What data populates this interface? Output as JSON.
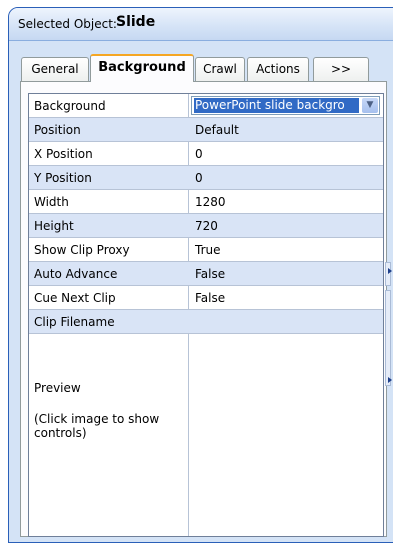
{
  "header": {
    "label": "Selected Object:",
    "value": "Slide"
  },
  "tabs": [
    {
      "label": "General",
      "active": false
    },
    {
      "label": "Background",
      "active": true
    },
    {
      "label": "Crawl",
      "active": false
    },
    {
      "label": "Actions",
      "active": false
    },
    {
      "label": ">>",
      "active": false
    }
  ],
  "properties": [
    {
      "name": "Background",
      "value": "PowerPoint slide backgro"
    },
    {
      "name": "Position",
      "value": "Default"
    },
    {
      "name": "X Position",
      "value": "0"
    },
    {
      "name": "Y Position",
      "value": "0"
    },
    {
      "name": "Width",
      "value": "1280"
    },
    {
      "name": "Height",
      "value": "720"
    },
    {
      "name": "Show Clip Proxy",
      "value": "True"
    },
    {
      "name": "Auto Advance",
      "value": "False"
    },
    {
      "name": "Cue Next Clip",
      "value": "False"
    },
    {
      "name": "Clip Filename",
      "value": ""
    }
  ],
  "preview": {
    "label": "Preview",
    "hint": "(Click image to show controls)"
  },
  "colors": {
    "panel_bg": "#d4e3f6",
    "panel_border": "#2a5fb8",
    "row_alt": "#d9e4f6",
    "selection": "#316ac5",
    "active_tab_accent": "#f5a623"
  }
}
